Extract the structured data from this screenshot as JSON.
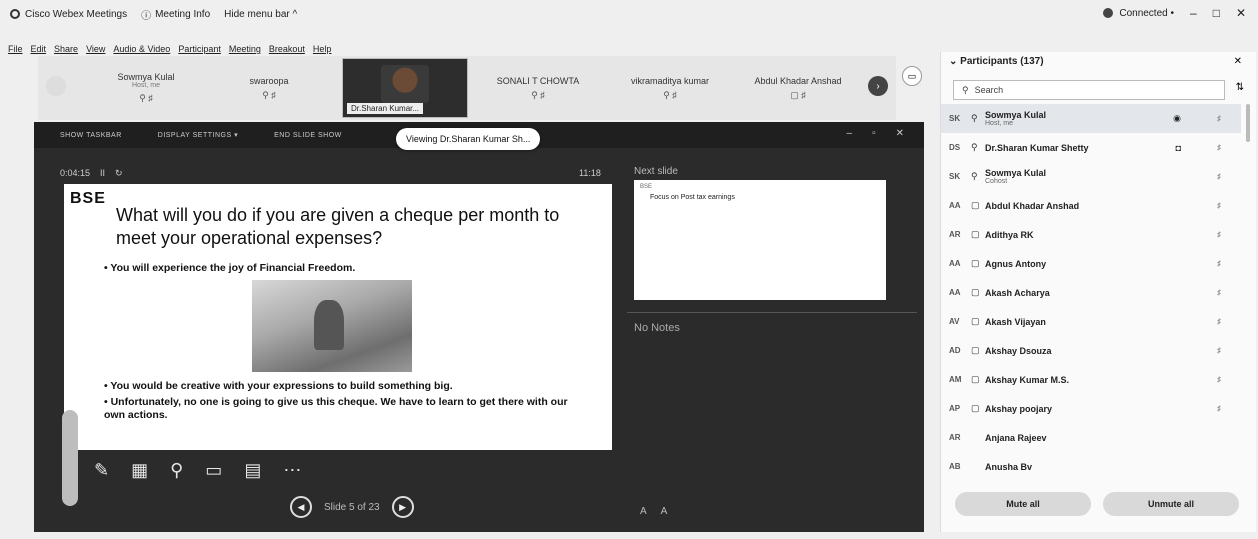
{
  "titlebar": {
    "app": "Cisco Webex Meetings",
    "meeting_info": "Meeting Info",
    "hide_menu": "Hide menu bar ^"
  },
  "menu": [
    "File",
    "Edit",
    "Share",
    "View",
    "Audio & Video",
    "Participant",
    "Meeting",
    "Breakout",
    "Help"
  ],
  "window": {
    "connected": "Connected •",
    "minimize": "–",
    "maximize": "□",
    "close": "✕"
  },
  "strip": {
    "tiles": [
      {
        "name": "Sowmya Kulal",
        "sub": "Host, me",
        "icons": "⚲ ♯"
      },
      {
        "name": "swaroopa",
        "sub": "",
        "icons": "⚲ ♯"
      },
      {
        "name": "Dr.Sharan Kumar...",
        "sub": "",
        "icons": ""
      },
      {
        "name": "SONALI T CHOWTA",
        "sub": "",
        "icons": "⚲ ♯"
      },
      {
        "name": "vikramaditya kumar",
        "sub": "",
        "icons": "⚲ ♯"
      },
      {
        "name": "Abdul Khadar Anshad",
        "sub": "",
        "icons": "▢ ♯"
      }
    ],
    "next_arrow": "›"
  },
  "presenter": {
    "tools": [
      "SHOW TASKBAR",
      "DISPLAY SETTINGS ▾",
      "END SLIDE SHOW"
    ],
    "viewing": "Viewing Dr.Sharan Kumar Sh...",
    "timer": "0:04:15",
    "timer_pause": "II",
    "timer_reset": "↻",
    "clock": "11:18",
    "next_slide_label": "Next slide",
    "next_slide_logo": "BSE",
    "next_slide_text": "Focus on Post tax earnings",
    "no_notes": "No Notes",
    "slide": {
      "logo": "BSE",
      "title": "What will you do if you are given a cheque per month to meet your operational expenses?",
      "bullet1": "• You will experience the joy of Financial Freedom.",
      "bullet2": "• You would be creative with your expressions to build something big.",
      "bullet3": "• Unfortunately, no one is going to give us this cheque. We have to learn to get there with our own actions."
    },
    "slide_counter": "Slide 5 of 23",
    "prev": "◀",
    "next": "▶",
    "font_small": "A",
    "font_large": "A"
  },
  "participants": {
    "header": "Participants (137)",
    "search_placeholder": "Search",
    "list": [
      {
        "initials": "SK",
        "mic": "⚲",
        "name": "Sowmya Kulal",
        "sub": "Host, me",
        "extra": "◉"
      },
      {
        "initials": "DS",
        "mic": "⚲",
        "name": "Dr.Sharan Kumar Shetty",
        "sub": "",
        "extra": "◘"
      },
      {
        "initials": "SK",
        "mic": "⚲",
        "name": "Sowmya Kulal",
        "sub": "Cohost",
        "extra": ""
      },
      {
        "initials": "AA",
        "mic": "▢",
        "name": "Abdul Khadar Anshad",
        "sub": "",
        "extra": ""
      },
      {
        "initials": "AR",
        "mic": "▢",
        "name": "Adithya RK",
        "sub": "",
        "extra": ""
      },
      {
        "initials": "AA",
        "mic": "▢",
        "name": "Agnus Antony",
        "sub": "",
        "extra": ""
      },
      {
        "initials": "AA",
        "mic": "▢",
        "name": "Akash Acharya",
        "sub": "",
        "extra": ""
      },
      {
        "initials": "AV",
        "mic": "▢",
        "name": "Akash Vijayan",
        "sub": "",
        "extra": ""
      },
      {
        "initials": "AD",
        "mic": "▢",
        "name": "Akshay Dsouza",
        "sub": "",
        "extra": ""
      },
      {
        "initials": "AM",
        "mic": "▢",
        "name": "Akshay Kumar M.S.",
        "sub": "",
        "extra": ""
      },
      {
        "initials": "AP",
        "mic": "▢",
        "name": "Akshay poojary",
        "sub": "",
        "extra": ""
      },
      {
        "initials": "AR",
        "mic": "",
        "name": "Anjana Rajeev",
        "sub": "",
        "extra": ""
      },
      {
        "initials": "AB",
        "mic": "",
        "name": "Anusha Bv",
        "sub": "",
        "extra": ""
      }
    ],
    "mute_all": "Mute all",
    "unmute_all": "Unmute all"
  }
}
